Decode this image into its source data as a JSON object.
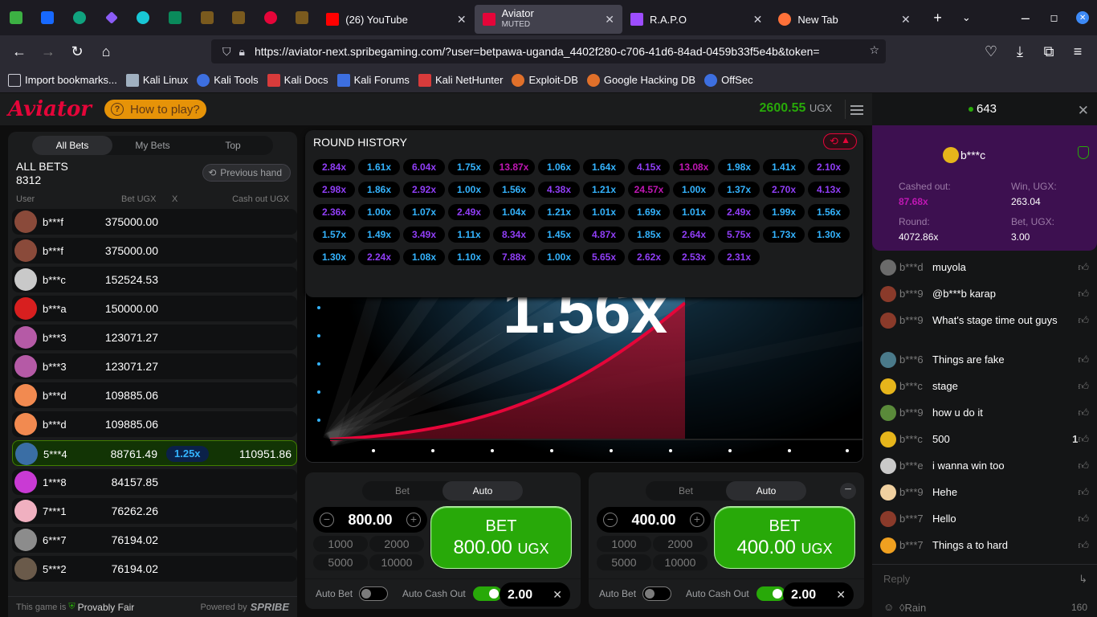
{
  "browser": {
    "tabs": [
      {
        "label": "(26) YouTube",
        "sub": ""
      },
      {
        "label": "Aviator",
        "sub": "MUTED"
      },
      {
        "label": "R.A.P.O",
        "sub": ""
      },
      {
        "label": "New Tab",
        "sub": ""
      }
    ],
    "url": "https://aviator-next.spribegaming.com/?user=betpawa-uganda_4402f280-c706-41d6-84ad-0459b33f5e4b&token=",
    "bookmarks": [
      "Import bookmarks...",
      "Kali Linux",
      "Kali Tools",
      "Kali Docs",
      "Kali Forums",
      "Kali NetHunter",
      "Exploit-DB",
      "Google Hacking DB",
      "OffSec"
    ]
  },
  "header": {
    "logo": "Aviator",
    "how_to": "How to play?",
    "balance": "2600.55",
    "currency": "UGX"
  },
  "bets": {
    "tabs": [
      "All Bets",
      "My Bets",
      "Top"
    ],
    "all_bets_label": "ALL BETS",
    "count": "8312",
    "prev_hand": "Previous hand",
    "columns": {
      "user": "User",
      "bet": "Bet UGX",
      "x": "X",
      "cashout": "Cash out UGX"
    },
    "rows": [
      {
        "user": "b***f",
        "bet": "375000.00",
        "mult": "",
        "cashout": ""
      },
      {
        "user": "b***f",
        "bet": "375000.00",
        "mult": "",
        "cashout": ""
      },
      {
        "user": "b***c",
        "bet": "152524.53",
        "mult": "",
        "cashout": ""
      },
      {
        "user": "b***a",
        "bet": "150000.00",
        "mult": "",
        "cashout": ""
      },
      {
        "user": "b***3",
        "bet": "123071.27",
        "mult": "",
        "cashout": ""
      },
      {
        "user": "b***3",
        "bet": "123071.27",
        "mult": "",
        "cashout": ""
      },
      {
        "user": "b***d",
        "bet": "109885.06",
        "mult": "",
        "cashout": ""
      },
      {
        "user": "b***d",
        "bet": "109885.06",
        "mult": "",
        "cashout": ""
      },
      {
        "user": "5***4",
        "bet": "88761.49",
        "mult": "1.25x",
        "cashout": "110951.86"
      },
      {
        "user": "1***8",
        "bet": "84157.85",
        "mult": "",
        "cashout": ""
      },
      {
        "user": "7***1",
        "bet": "76262.26",
        "mult": "",
        "cashout": ""
      },
      {
        "user": "6***7",
        "bet": "76194.02",
        "mult": "",
        "cashout": ""
      },
      {
        "user": "5***2",
        "bet": "76194.02",
        "mult": "",
        "cashout": ""
      }
    ],
    "footer_game": "This game is",
    "footer_fair": "Provably Fair",
    "footer_powered": "Powered by",
    "footer_brand": "SPRIBE"
  },
  "round_history": {
    "title": "ROUND HISTORY",
    "values": [
      "2.84x",
      "1.61x",
      "6.04x",
      "1.75x",
      "13.87x",
      "1.06x",
      "1.64x",
      "4.15x",
      "13.08x",
      "1.98x",
      "1.41x",
      "2.10x",
      "2.98x",
      "1.86x",
      "2.92x",
      "1.00x",
      "1.56x",
      "4.38x",
      "1.21x",
      "24.57x",
      "1.00x",
      "1.37x",
      "2.70x",
      "4.13x",
      "2.36x",
      "1.00x",
      "1.07x",
      "2.49x",
      "1.04x",
      "1.21x",
      "1.01x",
      "1.69x",
      "1.01x",
      "2.49x",
      "1.99x",
      "1.56x",
      "1.57x",
      "1.49x",
      "3.49x",
      "1.11x",
      "8.34x",
      "1.45x",
      "4.87x",
      "1.85x",
      "2.64x",
      "5.75x",
      "1.73x",
      "1.30x",
      "1.30x",
      "2.24x",
      "1.08x",
      "1.10x",
      "7.88x",
      "1.00x",
      "5.65x",
      "2.62x",
      "2.53x",
      "2.31x"
    ]
  },
  "game": {
    "multiplier": "1.56x"
  },
  "bet_panels": [
    {
      "tabs": [
        "Bet",
        "Auto"
      ],
      "amount": "800.00",
      "quick": [
        "1000",
        "2000",
        "5000",
        "10000"
      ],
      "bet_label": "BET",
      "bet_amount": "800.00",
      "bet_currency": "UGX",
      "auto_bet": "Auto Bet",
      "auto_cashout": "Auto Cash Out",
      "cashout_value": "2.00"
    },
    {
      "tabs": [
        "Bet",
        "Auto"
      ],
      "amount": "400.00",
      "quick": [
        "1000",
        "2000",
        "5000",
        "10000"
      ],
      "bet_label": "BET",
      "bet_amount": "400.00",
      "bet_currency": "UGX",
      "auto_bet": "Auto Bet",
      "auto_cashout": "Auto Cash Out",
      "cashout_value": "2.00"
    }
  ],
  "chat": {
    "online": "643",
    "win_card": {
      "user": "b***c",
      "cashed_label": "Cashed out:",
      "cashed": "87.68x",
      "win_label": "Win, UGX:",
      "win": "263.04",
      "round_label": "Round:",
      "round": "4072.86x",
      "bet_label": "Bet, UGX:",
      "bet": "3.00"
    },
    "messages": [
      {
        "user": "b***d",
        "text": "muyola",
        "likes": ""
      },
      {
        "user": "b***9",
        "text": "@b***b karap",
        "likes": ""
      },
      {
        "user": "b***9",
        "text": "What's stage time out guys",
        "likes": ""
      },
      {
        "user": "b***6",
        "text": "Things are fake",
        "likes": ""
      },
      {
        "user": "b***c",
        "text": "stage",
        "likes": ""
      },
      {
        "user": "b***9",
        "text": "how u do it",
        "likes": ""
      },
      {
        "user": "b***c",
        "text": "500",
        "likes": "1"
      },
      {
        "user": "b***e",
        "text": "i wanna win too",
        "likes": ""
      },
      {
        "user": "b***9",
        "text": "Hehe",
        "likes": ""
      },
      {
        "user": "b***7",
        "text": "Hello",
        "likes": ""
      },
      {
        "user": "b***7",
        "text": "Things a to hard",
        "likes": ""
      }
    ],
    "reply_placeholder": "Reply",
    "rain": "Rain",
    "char_count": "160"
  },
  "colors": {
    "accent_red": "#e50539",
    "green": "#28a909",
    "blue_mult": "#34b4ff",
    "purple_mult": "#913ef8",
    "pink_mult": "#c017b4",
    "win_card": "#3d1050"
  }
}
